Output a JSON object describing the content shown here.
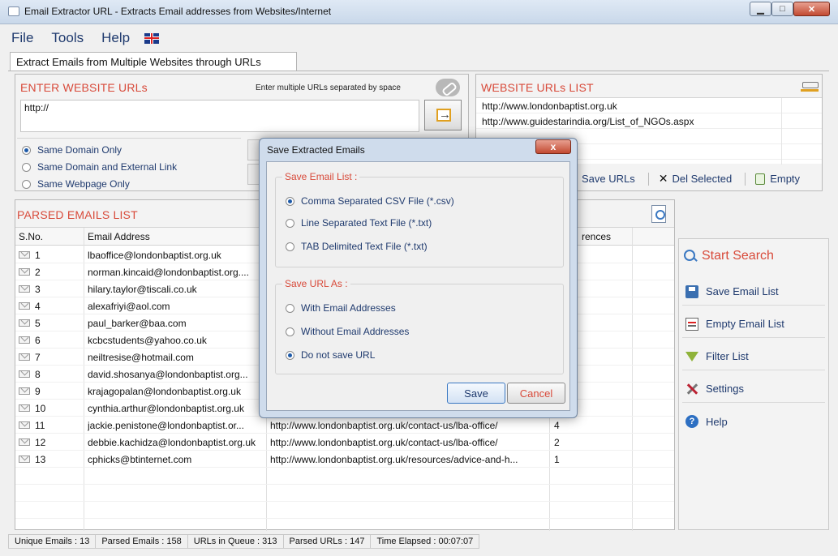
{
  "window": {
    "title": "Email Extractor URL - Extracts Email addresses from Websites/Internet"
  },
  "menu": {
    "file": "File",
    "tools": "Tools",
    "help": "Help"
  },
  "tab": {
    "label": "Extract Emails from Multiple Websites through URLs"
  },
  "enter_urls": {
    "title": "ENTER WEBSITE URLs",
    "hint": "Enter multiple URLs separated by space",
    "input_value": "http://",
    "options": [
      "Same Domain Only",
      "Same Domain and External Link",
      "Same Webpage Only"
    ],
    "selected": 0
  },
  "url_list": {
    "title": "WEBSITE URLs LIST",
    "items": [
      "http://www.londonbaptist.org.uk",
      "http://www.guidestarindia.org/List_of_NGOs.aspx"
    ],
    "save_urls": "Save URLs",
    "del_selected": "Del Selected",
    "empty": "Empty"
  },
  "parsed": {
    "title": "PARSED EMAILS LIST",
    "columns": {
      "sno": "S.No.",
      "email": "Email Address",
      "refs": "rences"
    },
    "rows": [
      {
        "sno": "1",
        "email": "lbaoffice@londonbaptist.org.uk",
        "url": "",
        "refs": ""
      },
      {
        "sno": "2",
        "email": "norman.kincaid@londonbaptist.org....",
        "url": "",
        "refs": ""
      },
      {
        "sno": "3",
        "email": "hilary.taylor@tiscali.co.uk",
        "url": "",
        "refs": ""
      },
      {
        "sno": "4",
        "email": "alexafriyi@aol.com",
        "url": "",
        "refs": ""
      },
      {
        "sno": "5",
        "email": "paul_barker@baa.com",
        "url": "",
        "refs": ""
      },
      {
        "sno": "6",
        "email": "kcbcstudents@yahoo.co.uk",
        "url": "",
        "refs": ""
      },
      {
        "sno": "7",
        "email": "neiltresise@hotmail.com",
        "url": "",
        "refs": ""
      },
      {
        "sno": "8",
        "email": "david.shosanya@londonbaptist.org...",
        "url": "",
        "refs": ""
      },
      {
        "sno": "9",
        "email": "krajagopalan@londonbaptist.org.uk",
        "url": "",
        "refs": ""
      },
      {
        "sno": "10",
        "email": "cynthia.arthur@londonbaptist.org.uk",
        "url": "",
        "refs": ""
      },
      {
        "sno": "11",
        "email": "jackie.penistone@londonbaptist.or...",
        "url": "http://www.londonbaptist.org.uk/contact-us/lba-office/",
        "refs": "4"
      },
      {
        "sno": "12",
        "email": "debbie.kachidza@londonbaptist.org.uk",
        "url": "http://www.londonbaptist.org.uk/contact-us/lba-office/",
        "refs": "2"
      },
      {
        "sno": "13",
        "email": "cphicks@btinternet.com",
        "url": "http://www.londonbaptist.org.uk/resources/advice-and-h...",
        "refs": "1"
      }
    ]
  },
  "side": {
    "start_search": "Start Search",
    "save_email_list": "Save Email List",
    "empty_email_list": "Empty Email List",
    "filter_list": "Filter List",
    "settings": "Settings",
    "help": "Help"
  },
  "status": {
    "unique": "Unique Emails : 13",
    "parsed": "Parsed Emails : 158",
    "queue": "URLs in Queue : 313",
    "parsed_urls": "Parsed URLs : 147",
    "elapsed": "Time Elapsed : 00:07:07"
  },
  "dialog": {
    "title": "Save Extracted Emails",
    "close": "x",
    "group1_title": "Save Email List :",
    "group1_options": [
      "Comma Separated CSV File (*.csv)",
      "Line Separated Text File (*.txt)",
      "TAB Delimited Text File (*.txt)"
    ],
    "group1_selected": 0,
    "group2_title": "Save URL As :",
    "group2_options": [
      "With Email Addresses",
      "Without Email Addresses",
      "Do not save URL"
    ],
    "group2_selected": 2,
    "save": "Save",
    "cancel": "Cancel"
  }
}
